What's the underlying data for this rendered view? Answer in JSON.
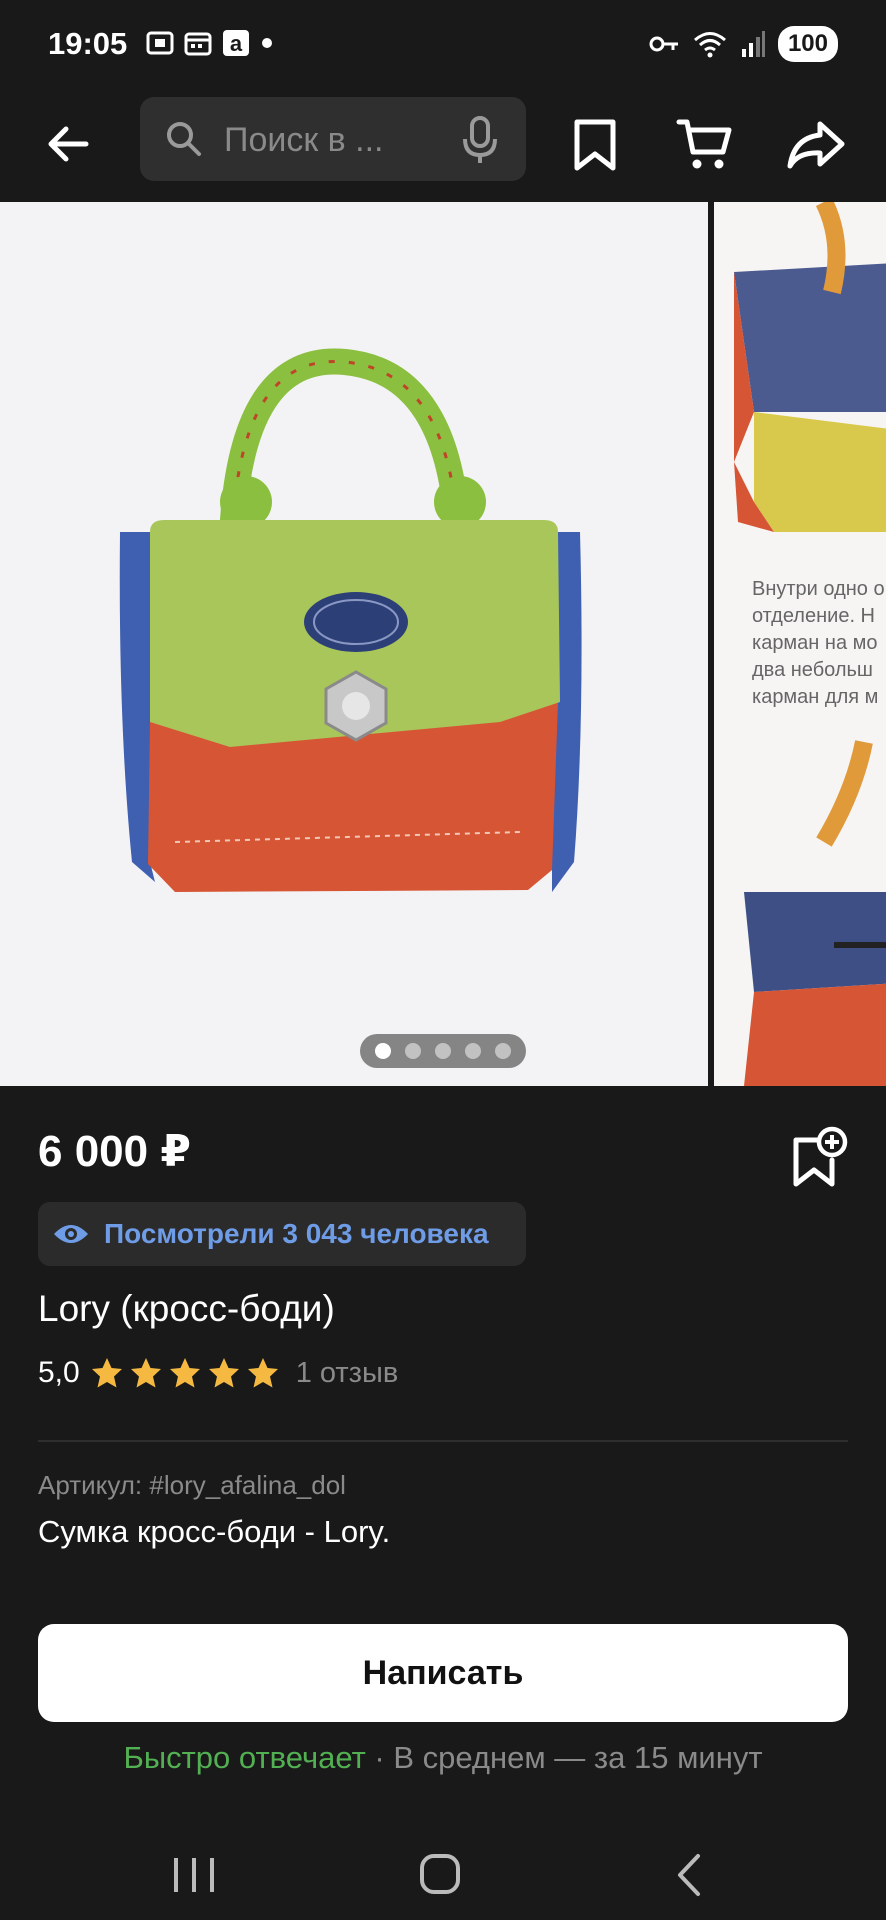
{
  "status_bar": {
    "time": "19:05",
    "battery": "100",
    "left_icons": [
      "screenshot-icon",
      "calendar-icon",
      "a-app-icon",
      "dot-icon"
    ],
    "right_icons": [
      "key-icon",
      "wifi-icon",
      "signal-icon"
    ]
  },
  "top_bar": {
    "search_placeholder": "Поиск в ...",
    "icons": [
      "back-arrow-icon",
      "search-icon",
      "mic-icon",
      "bookmark-icon",
      "cart-icon",
      "share-icon"
    ]
  },
  "gallery": {
    "next_slide_text": "Внутри одно о\nотделение. Н\nкарман на мо\nдва небольш\nкарман для м",
    "dots_total": 5,
    "active_dot": 1
  },
  "product": {
    "price": "6 000 ₽",
    "views": "Посмотрели 3 043 человека",
    "title": "Lory (кросс-боди)",
    "rating": "5,0",
    "stars": 5,
    "reviews": "1 отзыв",
    "article": "Артикул: #lory_afalina_dol",
    "description": "Сумка кросс-боди - Lory."
  },
  "actions": {
    "write_label": "Написать",
    "reply_fast": "Быстро отвечает",
    "reply_rest": " · В среднем  — за 15 минут"
  },
  "colors": {
    "background": "#191919",
    "accent_blue": "#6f9ce6",
    "accent_green": "#52b052",
    "star": "#f5b942"
  }
}
